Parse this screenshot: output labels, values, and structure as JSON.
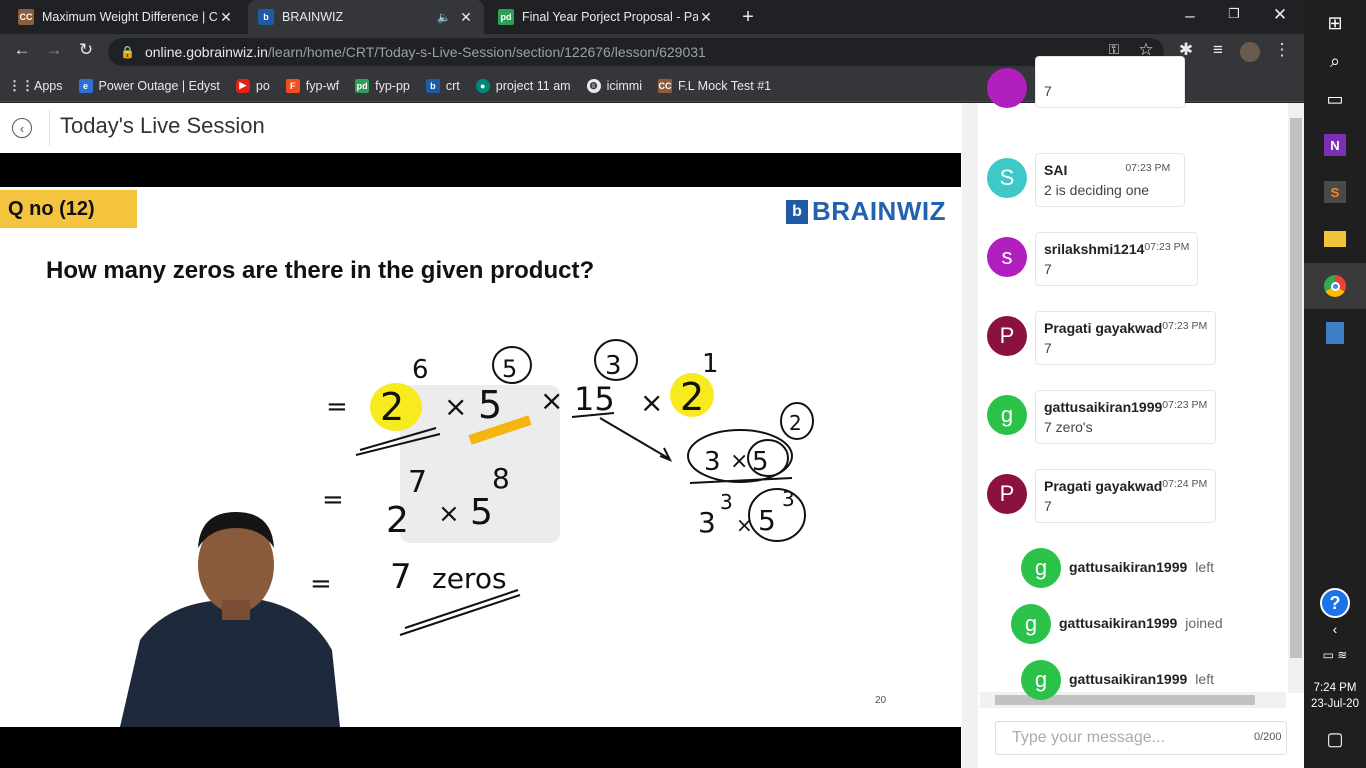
{
  "browser": {
    "tabs": [
      {
        "title": "Maximum Weight Difference | Co",
        "icon": "cc-icon",
        "color": "#8b5e3c"
      },
      {
        "title": "BRAINWIZ",
        "icon": "brainwiz-icon",
        "color": "#1f5aa6"
      },
      {
        "title": "Final Year Porject Proposal - Pand",
        "icon": "pd-icon",
        "color": "#2e9e58"
      }
    ],
    "url_host": "online.gobrainwiz.in",
    "url_path": "/learn/home/CRT/Today-s-Live-Session/section/122676/lesson/629031",
    "bookmarks": [
      {
        "label": "Apps",
        "icon": "apps-grid-icon",
        "color": "#e8eaed"
      },
      {
        "label": "Power Outage | Edyst",
        "icon": "edyst-icon",
        "color": "#2e6fd6"
      },
      {
        "label": "po",
        "icon": "youtube-icon",
        "color": "#e62117"
      },
      {
        "label": "fyp-wf",
        "icon": "figma-icon",
        "color": "#f24e1e"
      },
      {
        "label": "fyp-pp",
        "icon": "pd-icon",
        "color": "#2e9e58"
      },
      {
        "label": "crt",
        "icon": "brainwiz-icon",
        "color": "#1f5aa6"
      },
      {
        "label": "project 11 am",
        "icon": "meet-icon",
        "color": "#00897b"
      },
      {
        "label": "icimmi",
        "icon": "globe-icon",
        "color": "#e8eaed"
      },
      {
        "label": "F.L Mock Test #1",
        "icon": "cc-icon",
        "color": "#8b5e3c"
      }
    ]
  },
  "page": {
    "title": "Today's Live Session",
    "slide": {
      "qno": "Q no (12)",
      "brand": "BRAINWIZ",
      "question": "How many zeros are there in the given product?",
      "page_number": "20",
      "handwriting": {
        "line1": [
          "=",
          "2",
          "×",
          "5",
          "×",
          "15",
          "×",
          "2"
        ],
        "line1_exponents": [
          "6",
          "5",
          "3",
          "1"
        ],
        "line2": [
          "=",
          "2",
          "×",
          "5"
        ],
        "line2_exponents": [
          "7",
          "8"
        ],
        "line3": [
          "=",
          "7",
          "zeros"
        ],
        "side": [
          "3",
          "×",
          "5",
          "2",
          "3",
          "3",
          "×",
          "5",
          "3"
        ]
      }
    }
  },
  "chat": {
    "messages": [
      {
        "type": "msg",
        "initial": "",
        "color": "#b21fbf",
        "name": "",
        "time": "",
        "text": "7"
      },
      {
        "type": "msg",
        "initial": "S",
        "color": "#3fc8c8",
        "name": "SAI",
        "time": "07:23 PM",
        "text": "2 is deciding one"
      },
      {
        "type": "msg",
        "initial": "s",
        "color": "#b21fbf",
        "name": "srilakshmi1214",
        "time": "07:23 PM",
        "text": "7"
      },
      {
        "type": "msg",
        "initial": "P",
        "color": "#8a1140",
        "name": "Pragati gayakwad",
        "time": "07:23 PM",
        "text": "7"
      },
      {
        "type": "msg",
        "initial": "g",
        "color": "#2bc24a",
        "name": "gattusaikiran1999",
        "time": "07:23 PM",
        "text": "7 zero's"
      },
      {
        "type": "msg",
        "initial": "P",
        "color": "#8a1140",
        "name": "Pragati gayakwad",
        "time": "07:24 PM",
        "text": "7"
      },
      {
        "type": "event",
        "initial": "g",
        "color": "#2bc24a",
        "name": "gattusaikiran1999",
        "action": "left"
      },
      {
        "type": "event",
        "initial": "g",
        "color": "#2bc24a",
        "name": "gattusaikiran1999",
        "action": "joined"
      },
      {
        "type": "event",
        "initial": "g",
        "color": "#2bc24a",
        "name": "gattusaikiran1999",
        "action": "left"
      }
    ],
    "input_placeholder": "Type your message...",
    "char_count": "0/200"
  },
  "taskbar": {
    "time": "7:24 PM",
    "date": "23-Jul-20"
  }
}
